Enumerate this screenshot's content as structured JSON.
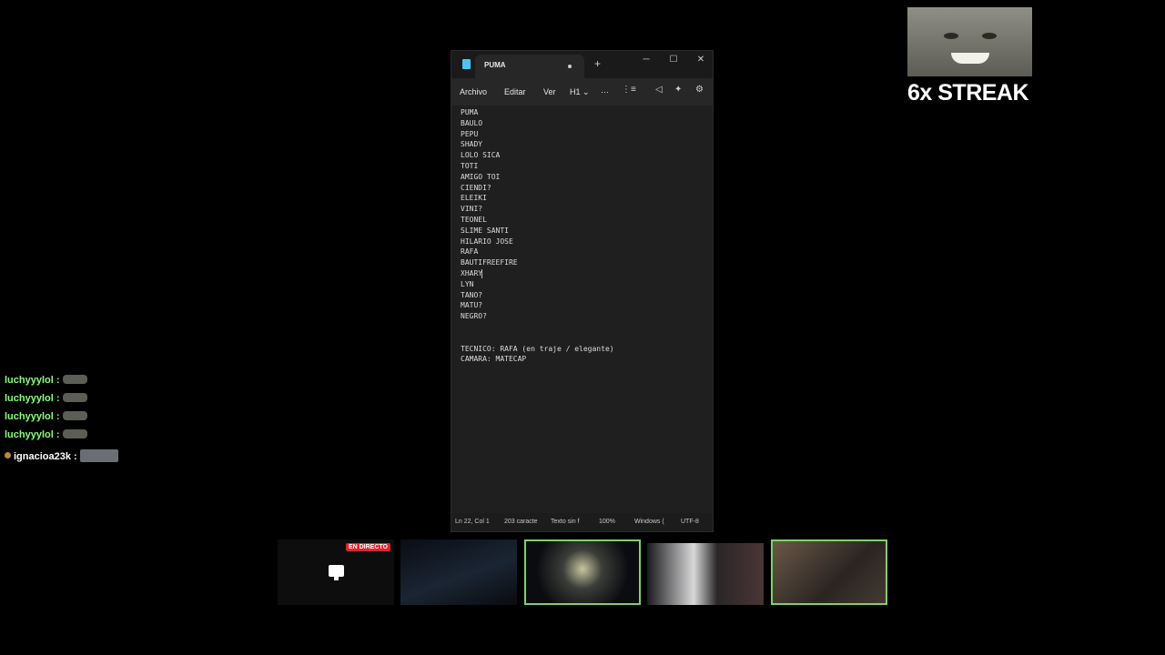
{
  "notepad": {
    "tab_title": "PUMA",
    "new_tab_icon": "+",
    "window_controls": {
      "minimize": "─",
      "maximize": "☐",
      "close": "✕"
    },
    "menu": {
      "file": "Archivo",
      "edit": "Editar",
      "view": "Ver",
      "heading": "H1",
      "more": "···"
    },
    "lines": [
      "PUMA",
      "BAULO",
      "PEPU",
      "SHADY",
      "LOLO SICA",
      "TOTI",
      "AMIGO TOI",
      "CIENDI?",
      "ELEIKI",
      "VINI?",
      "TEONEL",
      "SLIME SANTI",
      "HILARIO JOSE",
      "RAFA",
      "BAUTIFREEFIRE",
      "XHARY",
      "LYN",
      "TANO?",
      "MATU?",
      "NEGRO?",
      "",
      "",
      "TECNICO: RAFA (en traje / elegante)",
      "CAMARA: MATECAP"
    ],
    "status": {
      "position": "Ln 22, Col 1",
      "chars": "203 caracte",
      "format": "Texto sin f",
      "zoom": "100%",
      "line_ending": "Windows (",
      "encoding": "UTF-8"
    }
  },
  "overlay": {
    "streak_text": "6x STREAK"
  },
  "chat": {
    "messages": [
      {
        "user": "luchyyylol :"
      },
      {
        "user": "luchyyylol :"
      },
      {
        "user": "luchyyylol :"
      },
      {
        "user": "luchyyylol :"
      },
      {
        "user": "ignacioa23k :"
      }
    ]
  },
  "call": {
    "live_label": "EN DIRECTO"
  },
  "colors": {
    "chat_username": "#8aff7a",
    "speaking_border": "#7fd16a",
    "live_badge": "#e0232e",
    "editor_bg": "#1f1f1f"
  }
}
